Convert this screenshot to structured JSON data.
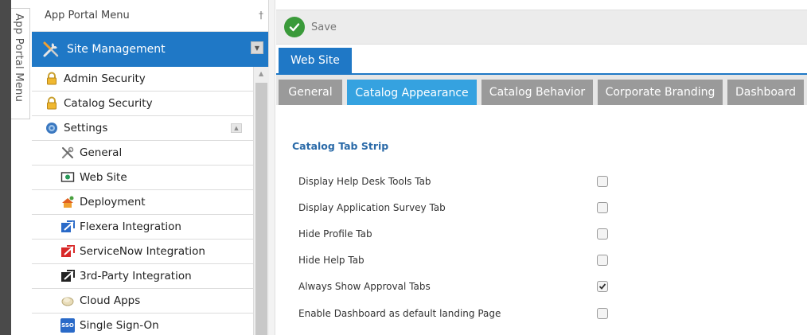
{
  "side_tab": {
    "label": "App Portal Menu"
  },
  "sidebar": {
    "header": "App Portal Menu",
    "pin_glyph": "†",
    "section": {
      "label": "Site Management",
      "icon": "tools-icon"
    },
    "items": [
      {
        "label": "Admin Security",
        "icon": "lock-icon",
        "level": 1
      },
      {
        "label": "Catalog Security",
        "icon": "lock-icon",
        "level": 1
      },
      {
        "label": "Settings",
        "icon": "gears-icon",
        "level": 1,
        "expanded": true
      },
      {
        "label": "General",
        "icon": "tools-icon",
        "level": 2
      },
      {
        "label": "Web Site",
        "icon": "monitor-icon",
        "level": 2
      },
      {
        "label": "Deployment",
        "icon": "deployment-icon",
        "level": 2
      },
      {
        "label": "Flexera Integration",
        "icon": "flexera-icon",
        "level": 2
      },
      {
        "label": "ServiceNow Integration",
        "icon": "servicenow-icon",
        "level": 2
      },
      {
        "label": "3rd-Party Integration",
        "icon": "third-party-icon",
        "level": 2
      },
      {
        "label": "Cloud Apps",
        "icon": "cloud-icon",
        "level": 2
      },
      {
        "label": "Single Sign-On",
        "icon": "sso-icon",
        "level": 2,
        "badge": "SSO"
      }
    ]
  },
  "toolbar": {
    "save_label": "Save",
    "save_icon": "check-circle-icon"
  },
  "top_tab": {
    "label": "Web Site"
  },
  "tabs": [
    {
      "label": "General",
      "active": false
    },
    {
      "label": "Catalog Appearance",
      "active": true
    },
    {
      "label": "Catalog Behavior",
      "active": false
    },
    {
      "label": "Corporate Branding",
      "active": false
    },
    {
      "label": "Dashboard",
      "active": false
    }
  ],
  "content": {
    "section_title": "Catalog Tab Strip",
    "options": [
      {
        "label": "Display Help Desk Tools Tab",
        "checked": false
      },
      {
        "label": "Display Application Survey Tab",
        "checked": false
      },
      {
        "label": "Hide Profile Tab",
        "checked": false
      },
      {
        "label": "Hide Help Tab",
        "checked": false
      },
      {
        "label": "Always Show Approval Tabs",
        "checked": true
      },
      {
        "label": "Enable Dashboard as default landing Page",
        "checked": false
      }
    ]
  },
  "colors": {
    "accent_blue": "#1f78c6",
    "active_tab": "#35a2e0",
    "inactive_tab": "#9a9a9a",
    "save_green": "#3a9a3a"
  }
}
